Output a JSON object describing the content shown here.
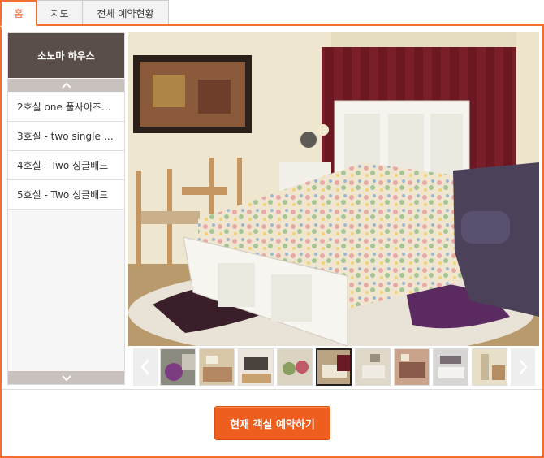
{
  "tabs": [
    {
      "label": "홈",
      "active": true
    },
    {
      "label": "지도",
      "active": false
    },
    {
      "label": "전체 예약현황",
      "active": false
    }
  ],
  "sidebar": {
    "house_name": "소노마 하우스",
    "rooms": [
      {
        "label": "2호실 one 풀사이즈…"
      },
      {
        "label": "3호실 - two single …"
      },
      {
        "label": "4호실 - Two 싱글배드"
      },
      {
        "label": "5호실 - Two 싱글배드"
      }
    ]
  },
  "gallery": {
    "main_photo_icon": "bedroom-photo",
    "thumbnail_count": 9,
    "selected_thumbnail": 5
  },
  "actions": {
    "book_label": "현재 객실 예약하기"
  },
  "colors": {
    "accent": "#f07030",
    "button": "#ee5f1f",
    "sidebar_header": "#5a4e4a"
  }
}
